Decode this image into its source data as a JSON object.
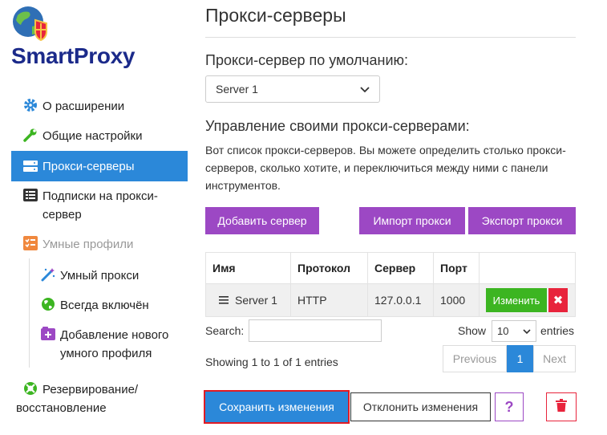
{
  "app": {
    "brand": "SmartProxy"
  },
  "sidebar": {
    "items": [
      {
        "label": "О расширении",
        "icon": "gear-icon"
      },
      {
        "label": "Общие настройки",
        "icon": "wrench-icon"
      },
      {
        "label": "Прокси-серверы",
        "icon": "server-icon"
      },
      {
        "label": "Подписки на прокси-сервер",
        "icon": "list-icon"
      },
      {
        "label": "Умные профили",
        "icon": "profile-list-icon"
      }
    ],
    "subitems": [
      {
        "label": "Умный прокси",
        "icon": "magic-wand-icon"
      },
      {
        "label": "Всегда включён",
        "icon": "globe-icon"
      },
      {
        "label": "Добавление нового умного профиля",
        "icon": "plus-square-icon"
      }
    ],
    "backup": {
      "label": "Резервирование/восстановление",
      "icon": "life-ring-icon"
    }
  },
  "page": {
    "title": "Прокси-серверы",
    "default_proxy_label": "Прокси-сервер по умолчанию:",
    "default_proxy_value": "Server 1",
    "manage_title": "Управление своими прокси-серверами:",
    "description": "Вот список прокси-серверов. Вы можете определить столько прокси-серверов, сколько хотите, и переключиться между ними с панели инструментов."
  },
  "buttons": {
    "add": "Добавить сервер",
    "import": "Импорт прокси",
    "export": "Экспорт прокси",
    "edit": "Изменить",
    "delete": "✖",
    "save": "Сохранить изменения",
    "cancel": "Отклонить изменения",
    "help": "?"
  },
  "table": {
    "headers": [
      "Имя",
      "Протокол",
      "Сервер",
      "Порт",
      ""
    ],
    "rows": [
      {
        "name": "Server 1",
        "protocol": "HTTP",
        "server": "127.0.0.1",
        "port": "1000"
      }
    ]
  },
  "datatable": {
    "search_label": "Search:",
    "search_value": "",
    "show_label": "Show",
    "page_length": "10",
    "entries_label": "entries",
    "info": "Showing 1 to 1 of 1 entries",
    "previous": "Previous",
    "current_page": "1",
    "next": "Next"
  },
  "colors": {
    "accent": "#2b88d9",
    "purple": "#9c48c4",
    "success": "#3cb521",
    "danger": "#e8243c",
    "brand": "#1b2a8a"
  }
}
